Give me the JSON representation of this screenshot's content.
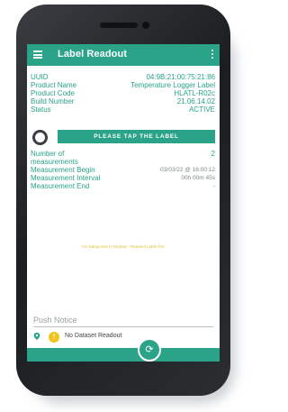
{
  "app": {
    "title": "Label Readout",
    "accent_color": "#2aa389"
  },
  "device_info": [
    {
      "label": "UUID",
      "value": "04:9B:21:00:75:21:86"
    },
    {
      "label": "Product Name",
      "value": "Temperature Logger Label"
    },
    {
      "label": "Product Code",
      "value": "HLATL-R02c"
    },
    {
      "label": "Build Number",
      "value": "21.06.14.02"
    },
    {
      "label": "Status",
      "value": "ACTIVE"
    }
  ],
  "tap_button": {
    "label": "PLEASE TAP THE LABEL"
  },
  "measurements": [
    {
      "label": "Number of measurements",
      "value": "2"
    },
    {
      "label": "Measurement Begin",
      "value": "03/03/22 @ 16:00:12"
    },
    {
      "label": "Measurement Interval",
      "value": "00h 00m 45s"
    },
    {
      "label": "Measurement End",
      "value": "-"
    }
  ],
  "empty_message": "No Datapoints to Display - Readout Label first",
  "push_notice": {
    "label": "Push Notice"
  },
  "footer": {
    "badge": "!",
    "dataset_text": "No Dataset Readout"
  },
  "icons": [
    "menu-icon",
    "more-vert-icon",
    "nfc-ring-icon",
    "location-pin-icon",
    "warning-badge-icon",
    "refresh-icon"
  ]
}
